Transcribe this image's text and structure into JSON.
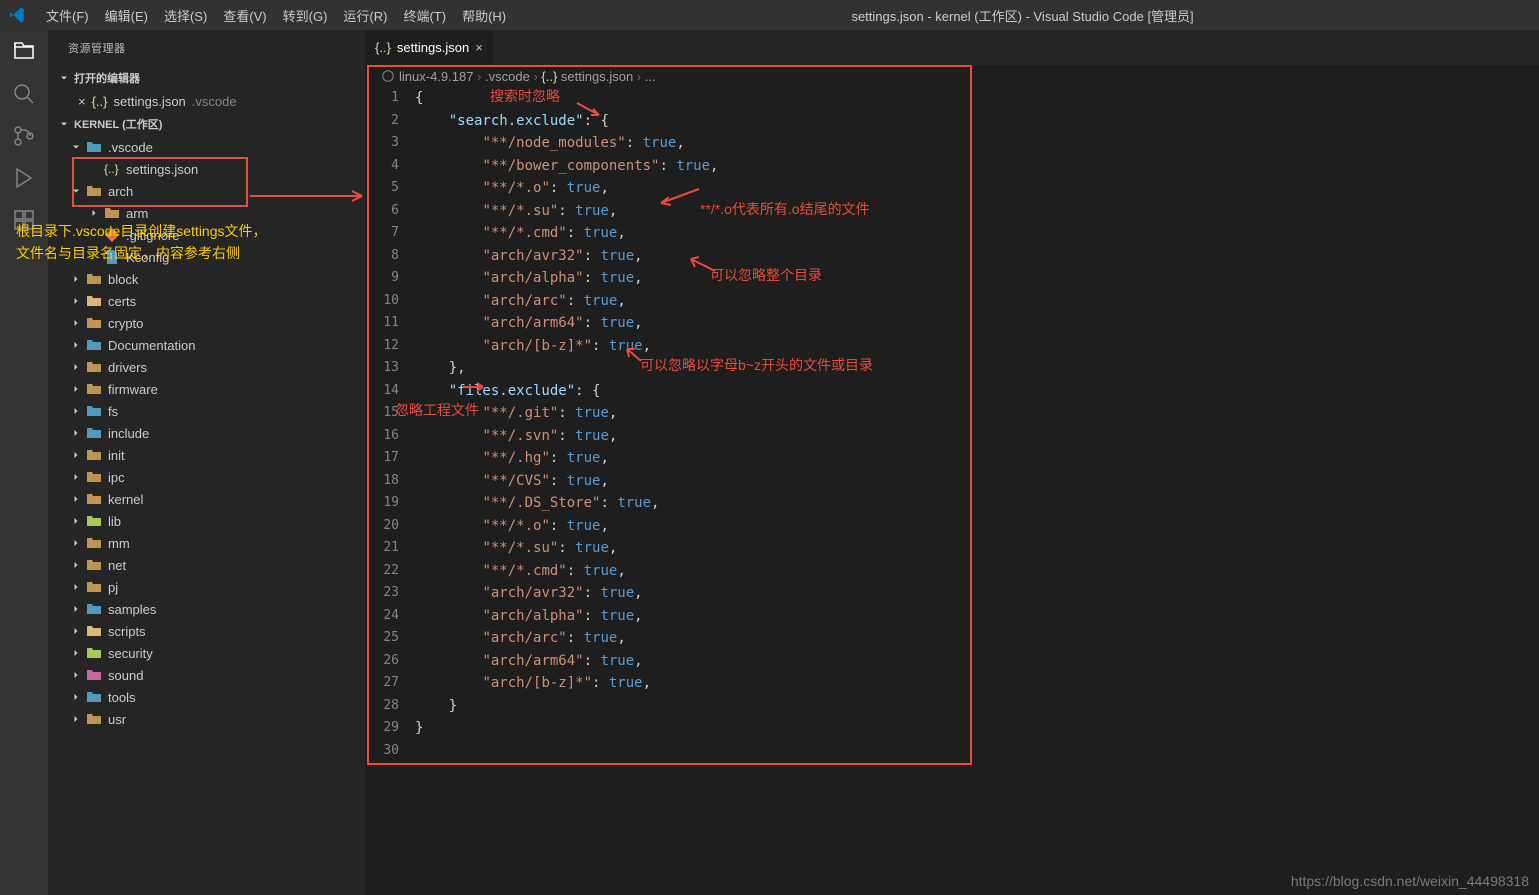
{
  "titlebar": {
    "menus": [
      "文件(F)",
      "编辑(E)",
      "选择(S)",
      "查看(V)",
      "转到(G)",
      "运行(R)",
      "终端(T)",
      "帮助(H)"
    ],
    "title": "settings.json - kernel (工作区) - Visual Studio Code [管理员]"
  },
  "sidebar": {
    "title": "资源管理器",
    "open_editors": "打开的编辑器",
    "open_file": "settings.json",
    "open_file_folder": ".vscode",
    "workspace": "KERNEL (工作区)",
    "tree": [
      {
        "type": "folder-open",
        "name": ".vscode",
        "depth": 1,
        "color": "#519aba"
      },
      {
        "type": "json",
        "name": "settings.json",
        "depth": 2
      },
      {
        "type": "folder-open",
        "name": "arch",
        "depth": 1,
        "color": "#c09553"
      },
      {
        "type": "folder",
        "name": "arm",
        "depth": 2,
        "color": "#c09553"
      },
      {
        "type": "git",
        "name": ".gitignore",
        "depth": 2
      },
      {
        "type": "file",
        "name": "Kconfig",
        "depth": 2
      },
      {
        "type": "folder",
        "name": "block",
        "depth": 1,
        "color": "#c09553"
      },
      {
        "type": "folder",
        "name": "certs",
        "depth": 1,
        "color": "#dcb67a"
      },
      {
        "type": "folder",
        "name": "crypto",
        "depth": 1,
        "color": "#c09553"
      },
      {
        "type": "folder",
        "name": "Documentation",
        "depth": 1,
        "color": "#519aba"
      },
      {
        "type": "folder",
        "name": "drivers",
        "depth": 1,
        "color": "#c09553"
      },
      {
        "type": "folder",
        "name": "firmware",
        "depth": 1,
        "color": "#c09553"
      },
      {
        "type": "folder",
        "name": "fs",
        "depth": 1,
        "color": "#519aba"
      },
      {
        "type": "folder",
        "name": "include",
        "depth": 1,
        "color": "#519aba"
      },
      {
        "type": "folder",
        "name": "init",
        "depth": 1,
        "color": "#c09553"
      },
      {
        "type": "folder",
        "name": "ipc",
        "depth": 1,
        "color": "#c09553"
      },
      {
        "type": "folder",
        "name": "kernel",
        "depth": 1,
        "color": "#c09553"
      },
      {
        "type": "folder",
        "name": "lib",
        "depth": 1,
        "color": "#a7c958"
      },
      {
        "type": "folder",
        "name": "mm",
        "depth": 1,
        "color": "#c09553"
      },
      {
        "type": "folder",
        "name": "net",
        "depth": 1,
        "color": "#c09553"
      },
      {
        "type": "folder",
        "name": "pj",
        "depth": 1,
        "color": "#c09553"
      },
      {
        "type": "folder",
        "name": "samples",
        "depth": 1,
        "color": "#519aba"
      },
      {
        "type": "folder",
        "name": "scripts",
        "depth": 1,
        "color": "#dcb67a"
      },
      {
        "type": "folder",
        "name": "security",
        "depth": 1,
        "color": "#a7c958"
      },
      {
        "type": "folder",
        "name": "sound",
        "depth": 1,
        "color": "#cc6699"
      },
      {
        "type": "folder",
        "name": "tools",
        "depth": 1,
        "color": "#519aba"
      },
      {
        "type": "folder",
        "name": "usr",
        "depth": 1,
        "color": "#c09553"
      }
    ]
  },
  "tab": {
    "name": "settings.json"
  },
  "breadcrumb": {
    "parts": [
      "linux-4.9.187",
      ".vscode",
      "settings.json",
      "..."
    ]
  },
  "code_lines": [
    [
      {
        "t": "brace",
        "v": "{"
      }
    ],
    [
      {
        "t": "indent",
        "v": "    "
      },
      {
        "t": "key",
        "v": "\"search.exclude\""
      },
      {
        "t": "punc",
        "v": ": "
      },
      {
        "t": "brace",
        "v": "{"
      }
    ],
    [
      {
        "t": "indent",
        "v": "        "
      },
      {
        "t": "str",
        "v": "\"**/node_modules\""
      },
      {
        "t": "punc",
        "v": ": "
      },
      {
        "t": "bool",
        "v": "true"
      },
      {
        "t": "punc",
        "v": ","
      }
    ],
    [
      {
        "t": "indent",
        "v": "        "
      },
      {
        "t": "str",
        "v": "\"**/bower_components\""
      },
      {
        "t": "punc",
        "v": ": "
      },
      {
        "t": "bool",
        "v": "true"
      },
      {
        "t": "punc",
        "v": ","
      }
    ],
    [
      {
        "t": "indent",
        "v": "        "
      },
      {
        "t": "str",
        "v": "\"**/*.o\""
      },
      {
        "t": "punc",
        "v": ": "
      },
      {
        "t": "bool",
        "v": "true"
      },
      {
        "t": "punc",
        "v": ","
      }
    ],
    [
      {
        "t": "indent",
        "v": "        "
      },
      {
        "t": "str",
        "v": "\"**/*.su\""
      },
      {
        "t": "punc",
        "v": ": "
      },
      {
        "t": "bool",
        "v": "true"
      },
      {
        "t": "punc",
        "v": ","
      }
    ],
    [
      {
        "t": "indent",
        "v": "        "
      },
      {
        "t": "str",
        "v": "\"**/*.cmd\""
      },
      {
        "t": "punc",
        "v": ": "
      },
      {
        "t": "bool",
        "v": "true"
      },
      {
        "t": "punc",
        "v": ","
      }
    ],
    [
      {
        "t": "indent",
        "v": "        "
      },
      {
        "t": "str",
        "v": "\"arch/avr32\""
      },
      {
        "t": "punc",
        "v": ": "
      },
      {
        "t": "bool",
        "v": "true"
      },
      {
        "t": "punc",
        "v": ","
      }
    ],
    [
      {
        "t": "indent",
        "v": "        "
      },
      {
        "t": "str",
        "v": "\"arch/alpha\""
      },
      {
        "t": "punc",
        "v": ": "
      },
      {
        "t": "bool",
        "v": "true"
      },
      {
        "t": "punc",
        "v": ","
      }
    ],
    [
      {
        "t": "indent",
        "v": "        "
      },
      {
        "t": "str",
        "v": "\"arch/arc\""
      },
      {
        "t": "punc",
        "v": ": "
      },
      {
        "t": "bool",
        "v": "true"
      },
      {
        "t": "punc",
        "v": ","
      }
    ],
    [
      {
        "t": "indent",
        "v": "        "
      },
      {
        "t": "str",
        "v": "\"arch/arm64\""
      },
      {
        "t": "punc",
        "v": ": "
      },
      {
        "t": "bool",
        "v": "true"
      },
      {
        "t": "punc",
        "v": ","
      }
    ],
    [
      {
        "t": "indent",
        "v": "        "
      },
      {
        "t": "str",
        "v": "\"arch/[b-z]*\""
      },
      {
        "t": "punc",
        "v": ": "
      },
      {
        "t": "bool",
        "v": "true"
      },
      {
        "t": "punc",
        "v": ","
      }
    ],
    [
      {
        "t": "indent",
        "v": "    "
      },
      {
        "t": "brace",
        "v": "}"
      },
      {
        "t": "punc",
        "v": ","
      }
    ],
    [
      {
        "t": "indent",
        "v": "    "
      },
      {
        "t": "key",
        "v": "\"files.exclude\""
      },
      {
        "t": "punc",
        "v": ": "
      },
      {
        "t": "brace",
        "v": "{"
      }
    ],
    [
      {
        "t": "indent",
        "v": "        "
      },
      {
        "t": "str",
        "v": "\"**/.git\""
      },
      {
        "t": "punc",
        "v": ": "
      },
      {
        "t": "bool",
        "v": "true"
      },
      {
        "t": "punc",
        "v": ","
      }
    ],
    [
      {
        "t": "indent",
        "v": "        "
      },
      {
        "t": "str",
        "v": "\"**/.svn\""
      },
      {
        "t": "punc",
        "v": ": "
      },
      {
        "t": "bool",
        "v": "true"
      },
      {
        "t": "punc",
        "v": ","
      }
    ],
    [
      {
        "t": "indent",
        "v": "        "
      },
      {
        "t": "str",
        "v": "\"**/.hg\""
      },
      {
        "t": "punc",
        "v": ": "
      },
      {
        "t": "bool",
        "v": "true"
      },
      {
        "t": "punc",
        "v": ","
      }
    ],
    [
      {
        "t": "indent",
        "v": "        "
      },
      {
        "t": "str",
        "v": "\"**/CVS\""
      },
      {
        "t": "punc",
        "v": ": "
      },
      {
        "t": "bool",
        "v": "true"
      },
      {
        "t": "punc",
        "v": ","
      }
    ],
    [
      {
        "t": "indent",
        "v": "        "
      },
      {
        "t": "str",
        "v": "\"**/.DS_Store\""
      },
      {
        "t": "punc",
        "v": ": "
      },
      {
        "t": "bool",
        "v": "true"
      },
      {
        "t": "punc",
        "v": ","
      }
    ],
    [
      {
        "t": "indent",
        "v": "        "
      },
      {
        "t": "str",
        "v": "\"**/*.o\""
      },
      {
        "t": "punc",
        "v": ": "
      },
      {
        "t": "bool",
        "v": "true"
      },
      {
        "t": "punc",
        "v": ","
      }
    ],
    [
      {
        "t": "indent",
        "v": "        "
      },
      {
        "t": "str",
        "v": "\"**/*.su\""
      },
      {
        "t": "punc",
        "v": ": "
      },
      {
        "t": "bool",
        "v": "true"
      },
      {
        "t": "punc",
        "v": ","
      }
    ],
    [
      {
        "t": "indent",
        "v": "        "
      },
      {
        "t": "str",
        "v": "\"**/*.cmd\""
      },
      {
        "t": "punc",
        "v": ": "
      },
      {
        "t": "bool",
        "v": "true"
      },
      {
        "t": "punc",
        "v": ","
      }
    ],
    [
      {
        "t": "indent",
        "v": "        "
      },
      {
        "t": "str",
        "v": "\"arch/avr32\""
      },
      {
        "t": "punc",
        "v": ": "
      },
      {
        "t": "bool",
        "v": "true"
      },
      {
        "t": "punc",
        "v": ","
      }
    ],
    [
      {
        "t": "indent",
        "v": "        "
      },
      {
        "t": "str",
        "v": "\"arch/alpha\""
      },
      {
        "t": "punc",
        "v": ": "
      },
      {
        "t": "bool",
        "v": "true"
      },
      {
        "t": "punc",
        "v": ","
      }
    ],
    [
      {
        "t": "indent",
        "v": "        "
      },
      {
        "t": "str",
        "v": "\"arch/arc\""
      },
      {
        "t": "punc",
        "v": ": "
      },
      {
        "t": "bool",
        "v": "true"
      },
      {
        "t": "punc",
        "v": ","
      }
    ],
    [
      {
        "t": "indent",
        "v": "        "
      },
      {
        "t": "str",
        "v": "\"arch/arm64\""
      },
      {
        "t": "punc",
        "v": ": "
      },
      {
        "t": "bool",
        "v": "true"
      },
      {
        "t": "punc",
        "v": ","
      }
    ],
    [
      {
        "t": "indent",
        "v": "        "
      },
      {
        "t": "str",
        "v": "\"arch/[b-z]*\""
      },
      {
        "t": "punc",
        "v": ": "
      },
      {
        "t": "bool",
        "v": "true"
      },
      {
        "t": "punc",
        "v": ","
      }
    ],
    [
      {
        "t": "indent",
        "v": "    "
      },
      {
        "t": "brace",
        "v": "}"
      }
    ],
    [
      {
        "t": "brace",
        "v": "}"
      }
    ],
    [
      {
        "t": "indent",
        "v": ""
      }
    ]
  ],
  "annotations": {
    "a1": "搜索时忽略",
    "a2": "**/*.o代表所有.o结尾的文件",
    "a3": "可以忽略整个目录",
    "a4": "可以忽略以字母b~z开头的文件或目录",
    "a5": "忽略工程文件",
    "a6_yellow": "根目录下.vscode目录创建settings文件，\n文件名与目录名固定，内容参考右侧"
  },
  "watermark": "https://blog.csdn.net/weixin_44498318"
}
